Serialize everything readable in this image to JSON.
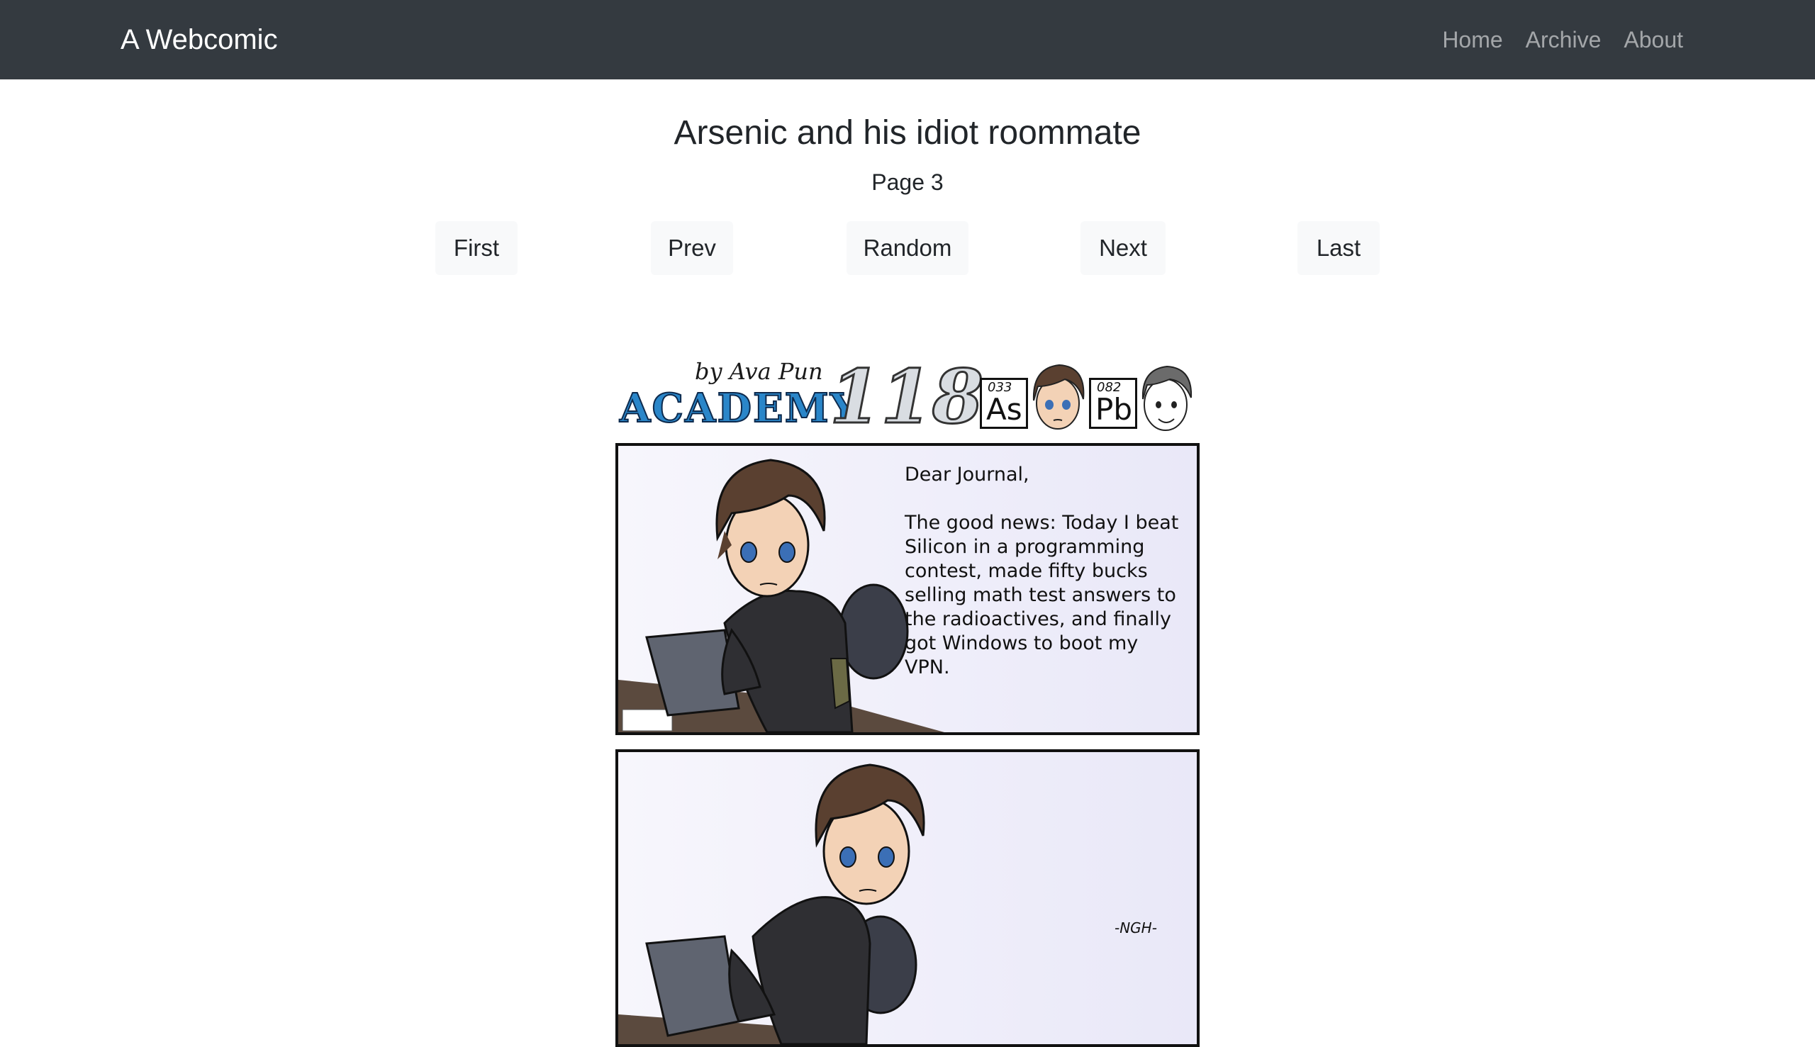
{
  "navbar": {
    "brand": "A Webcomic",
    "links": [
      "Home",
      "Archive",
      "About"
    ]
  },
  "comic": {
    "title": "Arsenic and his idiot roommate",
    "page": "Page 3"
  },
  "pager": {
    "first": "First",
    "prev": "Prev",
    "random": "Random",
    "next": "Next",
    "last": "Last"
  },
  "comic_header": {
    "byline": "by Ava Pun",
    "logo_word": "ACADEMY",
    "logo_number": "118",
    "element_1": {
      "number": "033",
      "symbol": "As"
    },
    "element_2": {
      "number": "082",
      "symbol": "Pb"
    }
  },
  "panel_1": {
    "text": "Dear Journal,\n\nThe good news: Today I beat Silicon in a programming contest, made fifty bucks selling math test answers to the radioactives, and finally got Windows to boot my VPN."
  },
  "panel_2": {
    "sfx": "-NGH-"
  },
  "colors": {
    "navbar_bg": "#343a40",
    "button_bg": "#f8f9fa",
    "logo_blue": "#2a86c9"
  }
}
